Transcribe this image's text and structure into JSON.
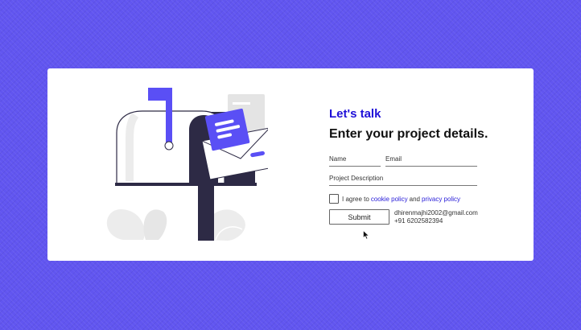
{
  "colors": {
    "background": "#6155f0",
    "card": "#ffffff",
    "accent": "#1f10d8",
    "illustration_primary": "#5a4ff5",
    "illustration_dark": "#2d2a45"
  },
  "form": {
    "heading_accent": "Let's talk",
    "heading_main": "Enter your project details.",
    "name_placeholder": "Name",
    "email_placeholder": "Email",
    "description_placeholder": "Project Description",
    "agree_prefix": "I agree to",
    "cookie_policy": "cookie policy",
    "agree_and": "and",
    "privacy_policy": "privacy policy",
    "submit_label": "Submit",
    "contact_email": "dhirenmajhi2002@gmail.com",
    "contact_phone": "+91 6202582394"
  },
  "icons": {
    "illustration": "mailbox-illustration",
    "cursor": "mouse-pointer-icon"
  }
}
